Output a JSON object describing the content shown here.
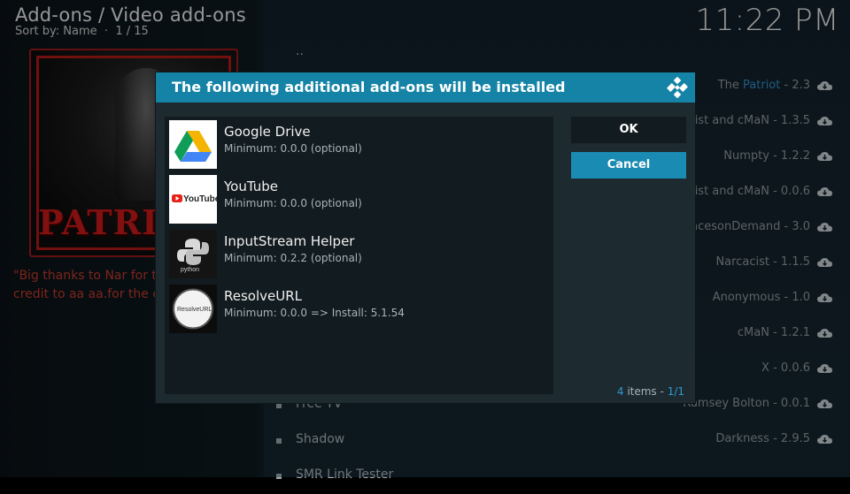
{
  "header": {
    "title": "Add-ons / Video add-ons",
    "sort_label": "Sort by: Name",
    "position": "1 / 15",
    "clock": "11:22 PM"
  },
  "poster": {
    "word": "PATRIOT"
  },
  "description": {
    "line1": "\"Big thanks to Nar for th",
    "line2": "credit to aa aa.for the or"
  },
  "list": {
    "items": [
      {
        "name": "..",
        "author": "",
        "version": ""
      },
      {
        "name": "",
        "author_prefix": "The ",
        "author_highlight": "Patriot",
        "version": "- 2.3"
      },
      {
        "name": "",
        "author": "acist and cMaN",
        "version": "- 1.3.5"
      },
      {
        "name": "",
        "author": "Numpty",
        "version": "- 1.2.2"
      },
      {
        "name": "",
        "author": "acist and cMaN",
        "version": "- 0.0.6"
      },
      {
        "name": "",
        "author": "RacesonDemand",
        "version": "- 3.0"
      },
      {
        "name": "",
        "author": "Narcacist",
        "version": "- 1.1.5"
      },
      {
        "name": "",
        "author": "Anonymous",
        "version": "- 1.0"
      },
      {
        "name": "",
        "author": "cMaN",
        "version": "- 1.2.1"
      },
      {
        "name": "",
        "author": "X",
        "version": "- 0.0.6"
      },
      {
        "name": "Free TV",
        "author": "Ramsey Bolton",
        "version": "- 0.0.1"
      },
      {
        "name": "Shadow",
        "author": "Darkness",
        "version": "- 2.9.5"
      },
      {
        "name": "SMR Link Tester",
        "author": "",
        "version": ""
      }
    ]
  },
  "dialog": {
    "title": "The following additional add-ons will be installed",
    "ok_label": "OK",
    "cancel_label": "Cancel",
    "items_count": "4",
    "items_label": "items",
    "page": "1/1",
    "addons": [
      {
        "name": "Google Drive",
        "meta": "Minimum: 0.0.0 (optional)",
        "icon": "google-drive-icon"
      },
      {
        "name": "YouTube",
        "meta": "Minimum: 0.0.0 (optional)",
        "icon": "youtube-icon",
        "icon_text": "YouTube"
      },
      {
        "name": "InputStream Helper",
        "meta": "Minimum: 0.2.2 (optional)",
        "icon": "python-icon",
        "icon_text": "python"
      },
      {
        "name": "ResolveURL",
        "meta": "Minimum: 0.0.0 => Install: 5.1.54",
        "icon": "resolveurl-icon",
        "icon_text": "ResolveURL"
      }
    ]
  },
  "colors": {
    "accent": "#1583a6",
    "dialog_bg": "#1d2a30",
    "description_red": "#c0392b"
  }
}
